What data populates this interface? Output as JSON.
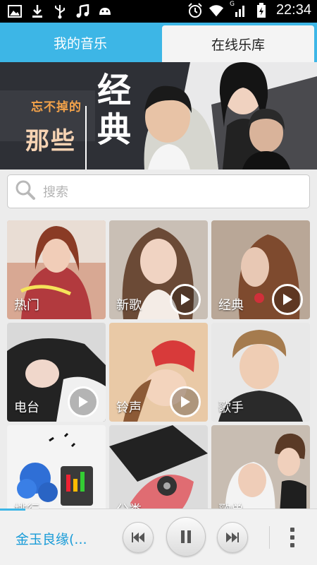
{
  "status_bar": {
    "time": "22:34",
    "left_icons": [
      "image-icon",
      "download-icon",
      "usb-icon",
      "music-note-icon",
      "android-icon"
    ],
    "right_icons": [
      "alarm-icon",
      "wifi-icon",
      "signal-icon",
      "battery-charging-icon"
    ],
    "signal_label": "G"
  },
  "tabs": [
    {
      "label": "我的音乐",
      "active": false
    },
    {
      "label": "在线乐库",
      "active": true
    }
  ],
  "banner": {
    "line1": "忘不掉的",
    "line2": "那些",
    "line3": "经典",
    "dot_count": 7,
    "active_dot": 1
  },
  "search": {
    "placeholder": "搜索"
  },
  "categories": [
    {
      "label": "热门",
      "has_play": false
    },
    {
      "label": "新歌",
      "has_play": true
    },
    {
      "label": "经典",
      "has_play": true
    },
    {
      "label": "电台",
      "has_play": true
    },
    {
      "label": "铃声",
      "has_play": true
    },
    {
      "label": "歌手",
      "has_play": false
    },
    {
      "label": "排行",
      "has_play": false
    },
    {
      "label": "分类",
      "has_play": false
    },
    {
      "label": "歌单",
      "has_play": false
    }
  ],
  "player": {
    "song_title": "金玉良缘(...",
    "progress": 0.08,
    "state": "playing"
  },
  "colors": {
    "accent": "#3db6e6",
    "song_title": "#1a9cd8",
    "banner_bg": "#2b2d33"
  }
}
